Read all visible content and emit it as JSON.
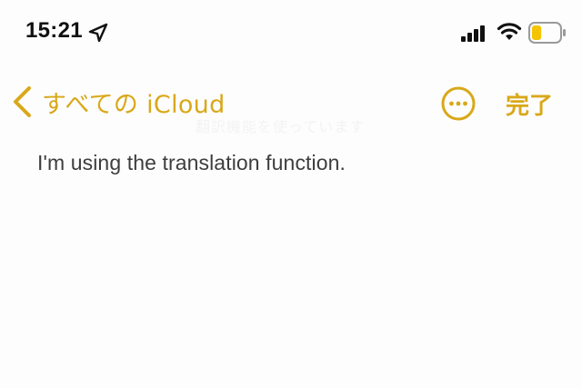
{
  "status_bar": {
    "time": "15:21",
    "icons": [
      "location-arrow-icon",
      "cellular-signal-icon",
      "wifi-icon",
      "battery-icon"
    ],
    "battery_level": 0.35,
    "battery_color": "#f5c400"
  },
  "nav": {
    "back_label": "すべての iCloud",
    "more_icon": "ellipsis-circle-icon",
    "done_label": "完了",
    "accent_color": "#d9a81a"
  },
  "note": {
    "faded_title": "翻訳機能を使っています",
    "body_text": "I'm using the translation function."
  }
}
